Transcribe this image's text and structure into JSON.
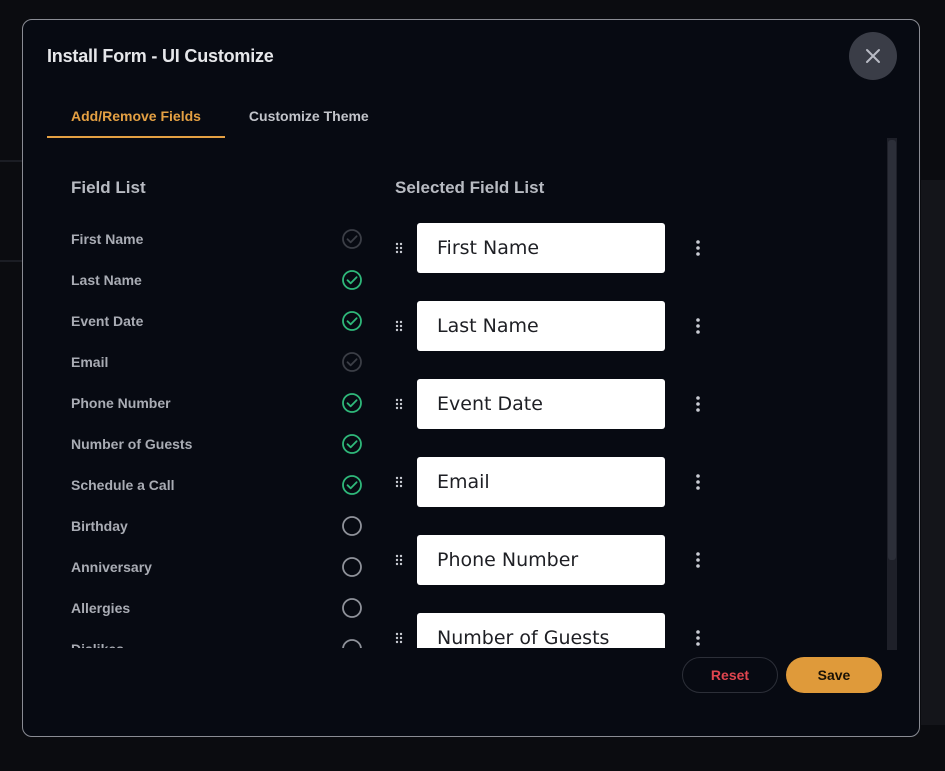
{
  "modal": {
    "title": "Install Form - UI Customize",
    "close_icon": "close-icon"
  },
  "tabs": [
    {
      "label": "Add/Remove Fields",
      "active": true
    },
    {
      "label": "Customize Theme",
      "active": false
    }
  ],
  "field_list": {
    "title": "Field List",
    "items": [
      {
        "label": "First Name",
        "state": "checked-disabled"
      },
      {
        "label": "Last Name",
        "state": "checked"
      },
      {
        "label": "Event Date",
        "state": "checked"
      },
      {
        "label": "Email",
        "state": "checked-disabled"
      },
      {
        "label": "Phone Number",
        "state": "checked"
      },
      {
        "label": "Number of Guests",
        "state": "checked"
      },
      {
        "label": "Schedule a Call",
        "state": "checked"
      },
      {
        "label": "Birthday",
        "state": "unchecked"
      },
      {
        "label": "Anniversary",
        "state": "unchecked"
      },
      {
        "label": "Allergies",
        "state": "unchecked"
      },
      {
        "label": "Dislikes",
        "state": "unchecked"
      }
    ]
  },
  "selected_field_list": {
    "title": "Selected Field List",
    "items": [
      {
        "value": "First Name"
      },
      {
        "value": "Last Name"
      },
      {
        "value": "Event Date"
      },
      {
        "value": "Email"
      },
      {
        "value": "Phone Number"
      },
      {
        "value": "Number of Guests"
      }
    ]
  },
  "actions": {
    "reset_label": "Reset",
    "save_label": "Save"
  },
  "colors": {
    "accent": "#e4a043",
    "check_green": "#2fb87a",
    "check_disabled": "#3b3e46",
    "reset_red": "#e0454f",
    "save_bg": "#df9a3a"
  }
}
